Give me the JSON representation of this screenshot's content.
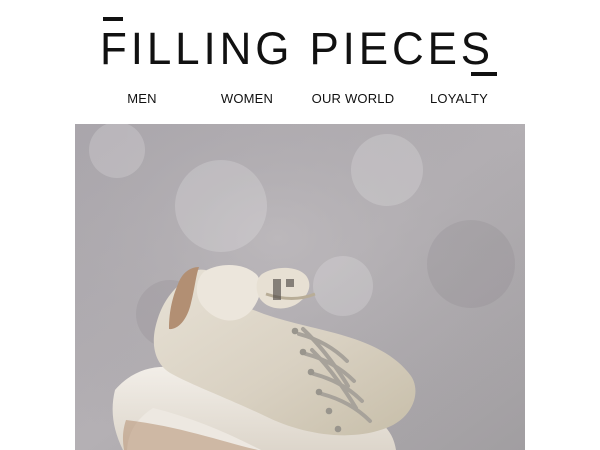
{
  "brand": {
    "name": "FILLING PIECES"
  },
  "nav": {
    "items": [
      {
        "label": "MEN"
      },
      {
        "label": "WOMEN"
      },
      {
        "label": "OUR WORLD"
      },
      {
        "label": "LOYALTY"
      }
    ]
  },
  "hero": {
    "image_subject": "sneaker-on-concrete"
  },
  "colors": {
    "text": "#111111",
    "background": "#ffffff",
    "hero_background": "#ada9ad",
    "sneaker_leather": "#ddd6c9",
    "sneaker_heel_tab": "#b08e74"
  }
}
